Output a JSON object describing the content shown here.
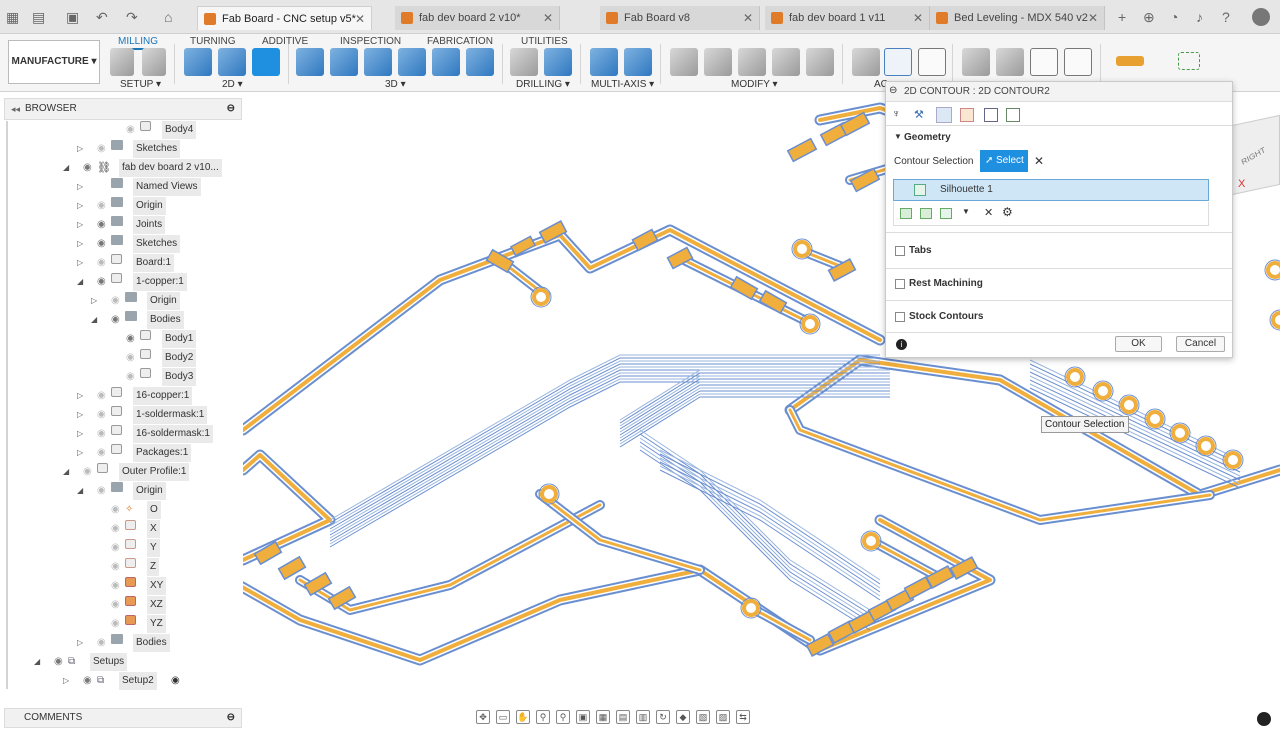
{
  "tabs": [
    {
      "label": "Fab Board - CNC setup v5*",
      "active": true
    },
    {
      "label": "fab dev board 2 v10*",
      "active": false
    },
    {
      "label": "Fab Board v8",
      "active": false
    },
    {
      "label": "fab dev board 1 v11",
      "active": false
    },
    {
      "label": "Bed Leveling - MDX 540 v2",
      "active": false
    }
  ],
  "workspace": "MANUFACTURE",
  "ribbon_tabs": [
    "MILLING",
    "TURNING",
    "ADDITIVE",
    "INSPECTION",
    "FABRICATION",
    "UTILITIES"
  ],
  "ribbon_groups": [
    "SETUP",
    "2D",
    "3D",
    "DRILLING",
    "MULTI-AXIS",
    "MODIFY",
    "AC"
  ],
  "browser": {
    "title": "BROWSER"
  },
  "tree": [
    {
      "label": "Body4",
      "indent": 4,
      "icon": "body",
      "eye": "off",
      "arrow": ""
    },
    {
      "label": "Sketches",
      "indent": 2,
      "icon": "folder",
      "eye": "off",
      "arrow": "right"
    },
    {
      "label": "fab dev board 2 v10...",
      "indent": 1,
      "icon": "link",
      "eye": "on",
      "arrow": "down"
    },
    {
      "label": "Named Views",
      "indent": 2,
      "icon": "folder",
      "eye": "",
      "arrow": "right"
    },
    {
      "label": "Origin",
      "indent": 2,
      "icon": "folder",
      "eye": "off",
      "arrow": "right"
    },
    {
      "label": "Joints",
      "indent": 2,
      "icon": "folder",
      "eye": "on",
      "arrow": "right"
    },
    {
      "label": "Sketches",
      "indent": 2,
      "icon": "folder",
      "eye": "on",
      "arrow": "right"
    },
    {
      "label": "Board:1",
      "indent": 2,
      "icon": "body",
      "eye": "off",
      "arrow": "right"
    },
    {
      "label": "1-copper:1",
      "indent": 2,
      "icon": "body",
      "eye": "on",
      "arrow": "down"
    },
    {
      "label": "Origin",
      "indent": 3,
      "icon": "folder",
      "eye": "off",
      "arrow": "right"
    },
    {
      "label": "Bodies",
      "indent": 3,
      "icon": "folder",
      "eye": "on",
      "arrow": "down"
    },
    {
      "label": "Body1",
      "indent": 4,
      "icon": "body",
      "eye": "on",
      "arrow": ""
    },
    {
      "label": "Body2",
      "indent": 4,
      "icon": "body",
      "eye": "off",
      "arrow": ""
    },
    {
      "label": "Body3",
      "indent": 4,
      "icon": "body",
      "eye": "off",
      "arrow": ""
    },
    {
      "label": "16-copper:1",
      "indent": 2,
      "icon": "body",
      "eye": "off",
      "arrow": "right"
    },
    {
      "label": "1-soldermask:1",
      "indent": 2,
      "icon": "body",
      "eye": "off",
      "arrow": "right"
    },
    {
      "label": "16-soldermask:1",
      "indent": 2,
      "icon": "body",
      "eye": "off",
      "arrow": "right"
    },
    {
      "label": "Packages:1",
      "indent": 2,
      "icon": "body",
      "eye": "off",
      "arrow": "right"
    },
    {
      "label": "Outer Profile:1",
      "indent": 1,
      "icon": "body",
      "eye": "off",
      "arrow": "down"
    },
    {
      "label": "Origin",
      "indent": 2,
      "icon": "folder",
      "eye": "off",
      "arrow": "down"
    },
    {
      "label": "O",
      "indent": 3,
      "icon": "point",
      "eye": "off",
      "arrow": ""
    },
    {
      "label": "X",
      "indent": 3,
      "icon": "axis",
      "eye": "off",
      "arrow": ""
    },
    {
      "label": "Y",
      "indent": 3,
      "icon": "axis",
      "eye": "off",
      "arrow": ""
    },
    {
      "label": "Z",
      "indent": 3,
      "icon": "axis",
      "eye": "off",
      "arrow": ""
    },
    {
      "label": "XY",
      "indent": 3,
      "icon": "plane",
      "eye": "off",
      "arrow": ""
    },
    {
      "label": "XZ",
      "indent": 3,
      "icon": "plane",
      "eye": "off",
      "arrow": ""
    },
    {
      "label": "YZ",
      "indent": 3,
      "icon": "plane",
      "eye": "off",
      "arrow": ""
    },
    {
      "label": "Bodies",
      "indent": 2,
      "icon": "folder",
      "eye": "off",
      "arrow": "right"
    },
    {
      "label": "Setups",
      "indent": 0,
      "icon": "setup",
      "eye": "on",
      "arrow": "down"
    },
    {
      "label": "Setup2",
      "indent": 1,
      "icon": "setup",
      "eye": "on",
      "arrow": "right"
    }
  ],
  "dialog": {
    "title": "2D CONTOUR : 2D CONTOUR2",
    "geometry_label": "Geometry",
    "contour_selection_label": "Contour Selection",
    "select_label": "Select",
    "selected_item": "Silhouette 1",
    "tabs_label": "Tabs",
    "rest_machining_label": "Rest Machining",
    "stock_contours_label": "Stock Contours",
    "ok_label": "OK",
    "cancel_label": "Cancel"
  },
  "tooltip": "Contour Selection",
  "comments": "COMMENTS",
  "viewcube_label": "RIGHT",
  "colors": {
    "accent": "#1b75bb",
    "select": "#1f8fe0",
    "pad": "#f0ae3c",
    "toolpath": "#6a8fd0",
    "tab_icon": "#e07b2a"
  }
}
